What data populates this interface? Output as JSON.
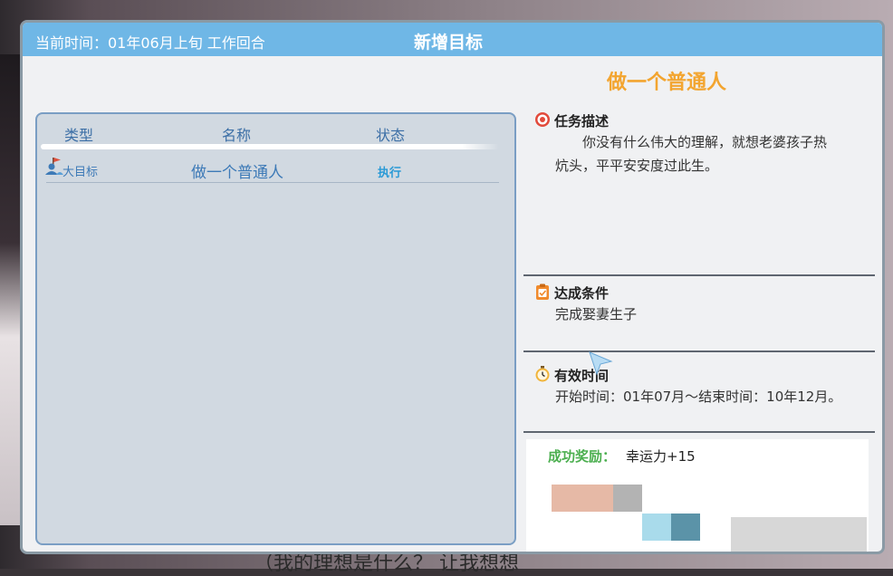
{
  "header": {
    "current_time": "当前时间：01年06月上旬 工作回合",
    "title": "新增目标"
  },
  "table": {
    "columns": [
      "类型",
      "名称",
      "状态"
    ],
    "rows": [
      {
        "type": "大目标",
        "name": "做一个普通人",
        "status": "执行"
      }
    ]
  },
  "detail": {
    "goal_name": "做一个普通人",
    "description": {
      "title": "任务描述",
      "body": "你没有什么伟大的理解，就想老婆孩子热炕头，平平安安度过此生。"
    },
    "condition": {
      "title": "达成条件",
      "body": "完成娶妻生子"
    },
    "time": {
      "title": "有效时间",
      "body": "开始时间：01年07月～结束时间：10年12月。"
    },
    "reward": {
      "label": "成功奖励：",
      "value": "幸运力+15"
    }
  },
  "background": {
    "dialog_text": "（我的理想是什么？ 让我想想"
  },
  "colors": {
    "titlebar": "#6fb7e6",
    "goal_title": "#f3a530",
    "reward_label": "#4caf50",
    "link_blue": "#3d7ab7"
  },
  "icons": {
    "goal_type": "flag-person-icon",
    "description": "target-icon",
    "condition": "clipboard-icon",
    "time": "stopwatch-icon"
  }
}
